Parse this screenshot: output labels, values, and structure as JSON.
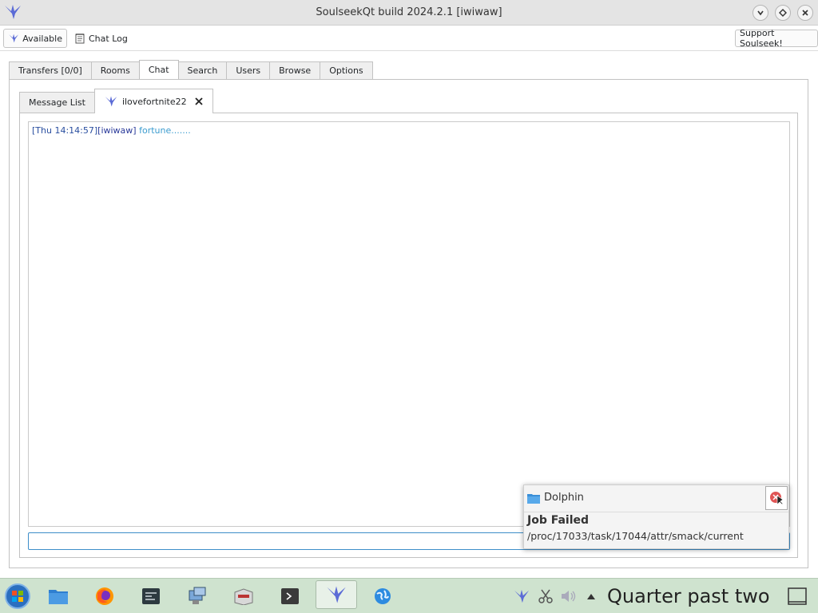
{
  "window": {
    "title": "SoulseekQt build 2024.2.1 [iwiwaw]"
  },
  "toolbar": {
    "status_label": "Available",
    "chatlog_label": "Chat Log",
    "support_label": "Support Soulseek!"
  },
  "main_tabs": [
    {
      "label": "Transfers [0/0]"
    },
    {
      "label": "Rooms"
    },
    {
      "label": "Chat"
    },
    {
      "label": "Search"
    },
    {
      "label": "Users"
    },
    {
      "label": "Browse"
    },
    {
      "label": "Options"
    }
  ],
  "chat_tabs": [
    {
      "label": "Message List"
    },
    {
      "label": "ilovefortnite22"
    }
  ],
  "chat": {
    "messages": [
      {
        "timestamp": "[Thu 14:14:57]",
        "user": "[iwiwaw]",
        "text": "fortune......."
      }
    ],
    "input_value": ""
  },
  "notification": {
    "app": "Dolphin",
    "title": "Job Failed",
    "body": "/proc/17033/task/17044/attr/smack/current"
  },
  "taskbar": {
    "clock": "Quarter past two",
    "icons": [
      "start-menu-icon",
      "file-manager-icon",
      "firefox-icon",
      "terminal-icon",
      "network-settings-icon",
      "package-manager-icon",
      "console-icon",
      "soulseek-icon",
      "browser-globe-icon"
    ]
  },
  "colors": {
    "accent": "#3d8ec9",
    "timestamp": "#2a4fa0",
    "message": "#3c9ccf",
    "taskbar": "#cfe3cf"
  }
}
